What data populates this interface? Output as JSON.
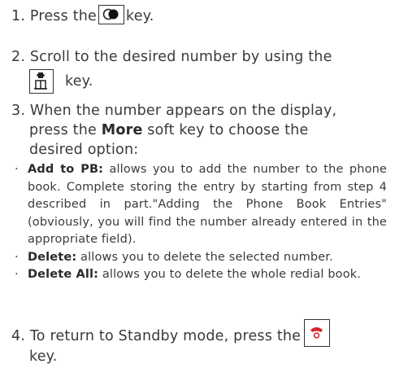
{
  "step1": {
    "num": "1.",
    "before": "Press the",
    "after": "key."
  },
  "step2": {
    "num": "2.",
    "line1": "Scroll to the desired number by using the",
    "after": "key."
  },
  "step3": {
    "num": "3.",
    "line1": "When the number appears on the display,",
    "line2_before": "press the",
    "line2_bold": "More",
    "line2_after": "soft key to choose the",
    "line3": "desired option:"
  },
  "bullets": [
    {
      "term": "Add to PB:",
      "text": " allows you to add the number to the phone book. Complete storing the entry by starting from step 4 described in part.\"Adding the Phone Book Entries\" (obviously, you will find the number already entered in the appropriate field)."
    },
    {
      "term": "Delete:",
      "text": " allows you to delete the selected number."
    },
    {
      "term": "Delete All:",
      "text": " allows you to delete the whole redial book."
    }
  ],
  "step4": {
    "num": "4.",
    "before": "To return to Standby mode, press the",
    "line2": "key."
  },
  "icons": {
    "flash_key": "flash-key-icon",
    "phonebook_key": "phonebook-key-icon",
    "end_key": "end-call-key-icon"
  },
  "colors": {
    "text": "#3a3a3a",
    "end_key": "#d9232a"
  }
}
